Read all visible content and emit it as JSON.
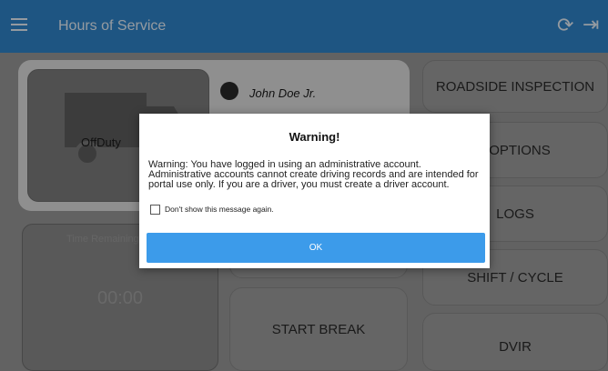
{
  "appbar": {
    "title": "Hours of Service"
  },
  "driver": {
    "name": "John Doe Jr."
  },
  "status": {
    "label": "OffDuty"
  },
  "timer": {
    "label": "Time Remaining",
    "value": "00:00"
  },
  "actions": {
    "roadside_inspection": "ROADSIDE INSPECTION",
    "options": "OPTIONS",
    "logs": "LOGS",
    "shift_cycle": "SHIFT / CYCLE",
    "start_break": "START BREAK",
    "dvir": "DVIR"
  },
  "dialog": {
    "title": "Warning!",
    "message": "Warning: You have logged in using an administrative account. Administrative accounts cannot create driving records and are intended for portal use only. If you are a driver, you must create a driver account.",
    "checkbox_label": "Don't show this message again.",
    "checkbox_checked": false,
    "ok_label": "OK"
  },
  "colors": {
    "appbar": "#2f86cc",
    "ok_button": "#3c9bea"
  }
}
